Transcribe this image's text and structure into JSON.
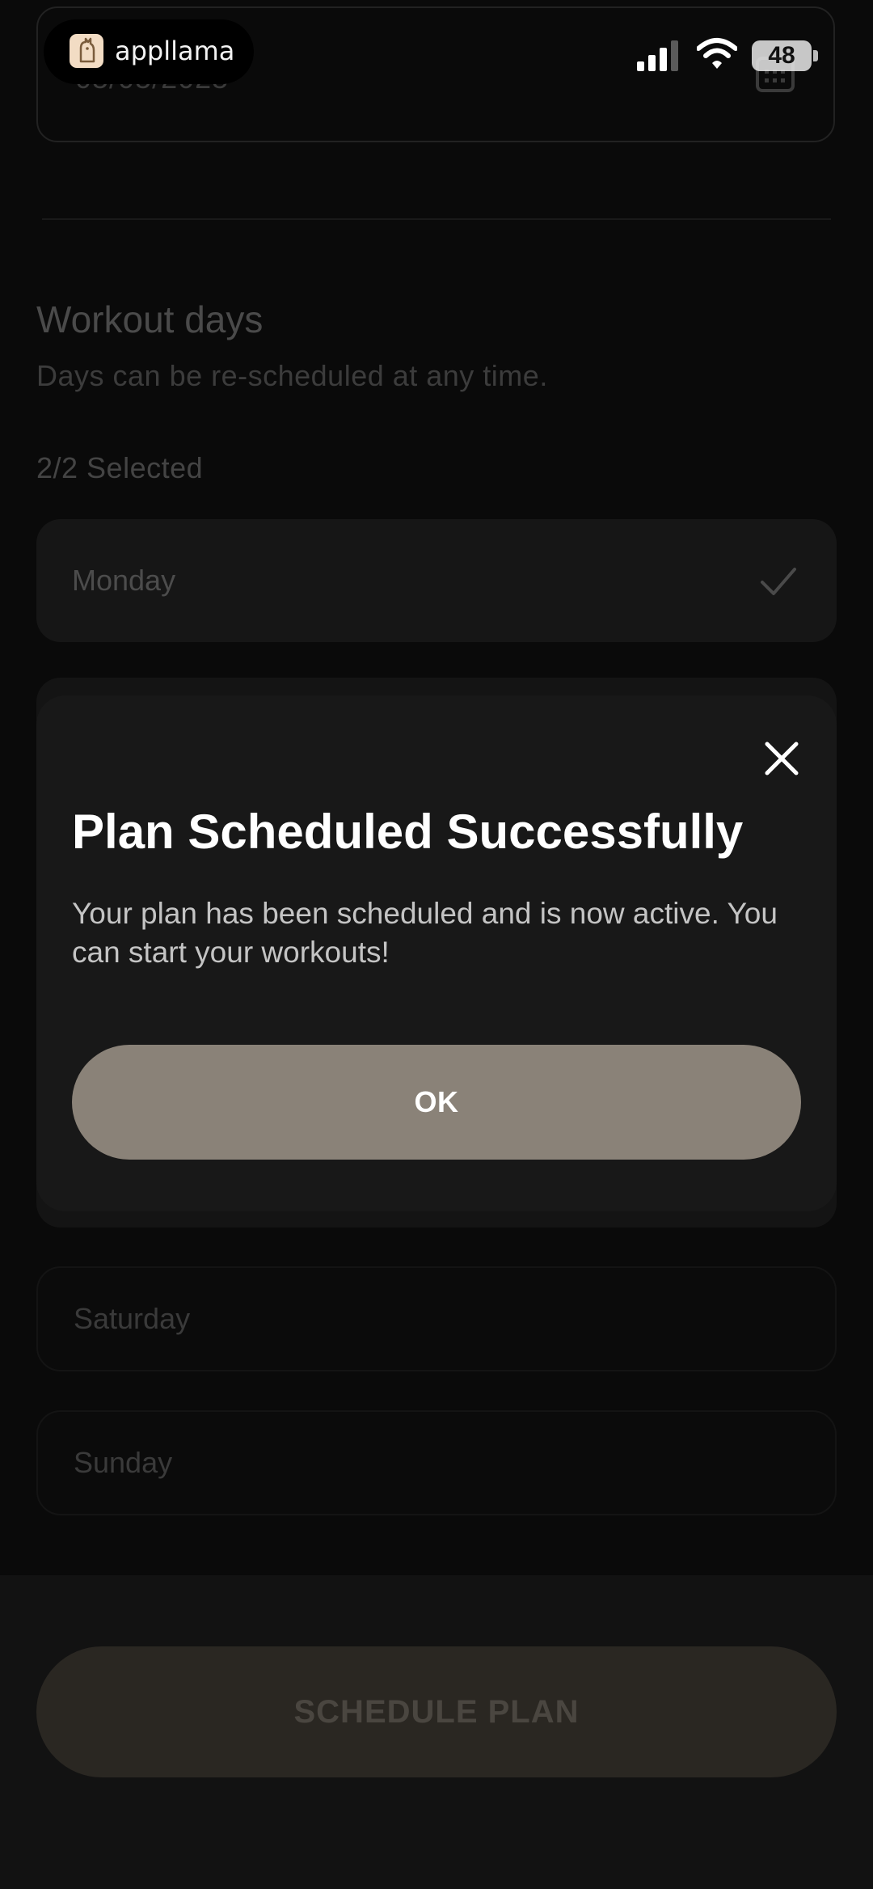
{
  "status_bar": {
    "app_name": "appllama",
    "battery": "48",
    "icons": [
      "signal-icon",
      "wifi-icon",
      "battery-icon"
    ]
  },
  "form": {
    "date_value": "05/05/2025",
    "date_icon": "calendar-icon",
    "workout_days": {
      "title": "Workout days",
      "subtitle": "Days can be re-scheduled at any time.",
      "selected_count": "2/2 Selected",
      "days": [
        {
          "label": "Monday",
          "selected": true
        },
        {
          "label": "Saturday",
          "selected": false
        },
        {
          "label": "Sunday",
          "selected": false
        }
      ]
    },
    "schedule_button_label": "SCHEDULE PLAN"
  },
  "modal": {
    "title": "Plan Scheduled Successfully",
    "message": "Your plan has been scheduled and is now active. You can start your workouts!",
    "ok_label": "OK",
    "close_icon": "close-icon"
  },
  "colors": {
    "background": "#0a0a0a",
    "modal_background": "#181818",
    "ok_button": "#8a8278",
    "schedule_button": "#2a2722"
  }
}
